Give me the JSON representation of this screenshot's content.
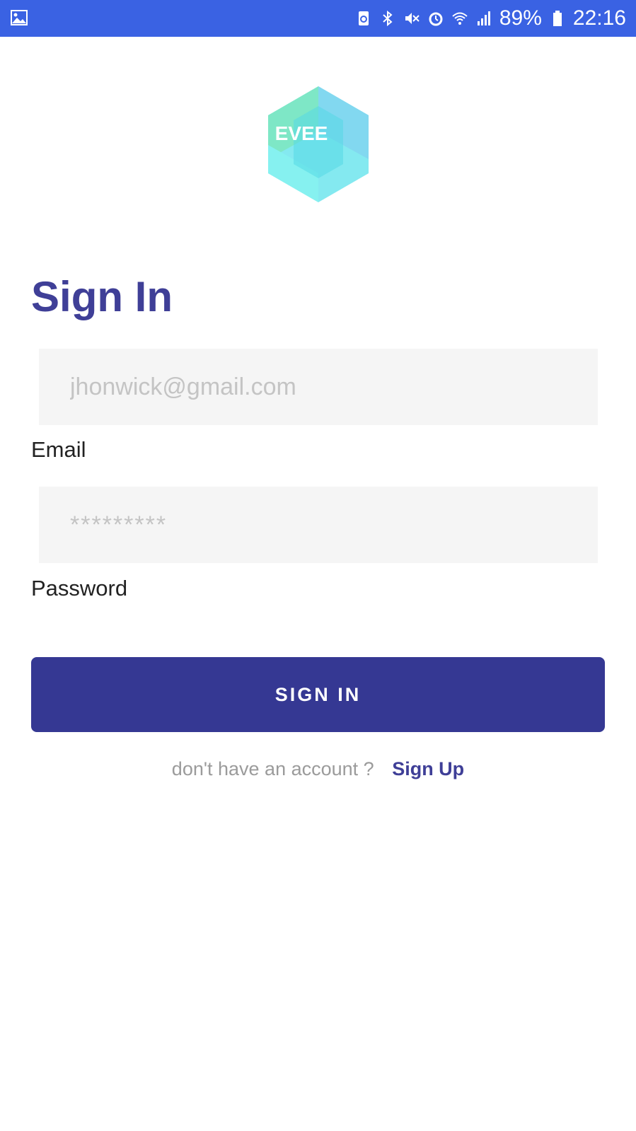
{
  "status_bar": {
    "battery_percent": "89%",
    "time": "22:16",
    "color": "#3a62e3",
    "icons": [
      "gallery-icon",
      "battery-saver-icon",
      "bluetooth-icon",
      "mute-icon",
      "alarm-icon",
      "wifi-icon",
      "signal-icon",
      "battery-icon"
    ]
  },
  "logo": {
    "text": "EVEE"
  },
  "signin": {
    "title": "Sign In",
    "email": {
      "placeholder": "jhonwick@gmail.com",
      "value": "",
      "label": "Email"
    },
    "password": {
      "placeholder": "*********",
      "value": "",
      "label": "Password"
    },
    "button_label": "SIGN IN",
    "signup_prompt": "don't have an account ?",
    "signup_link": "Sign Up"
  },
  "colors": {
    "primary": "#353893",
    "title": "#3f3f97",
    "field_background": "#f5f5f5"
  }
}
